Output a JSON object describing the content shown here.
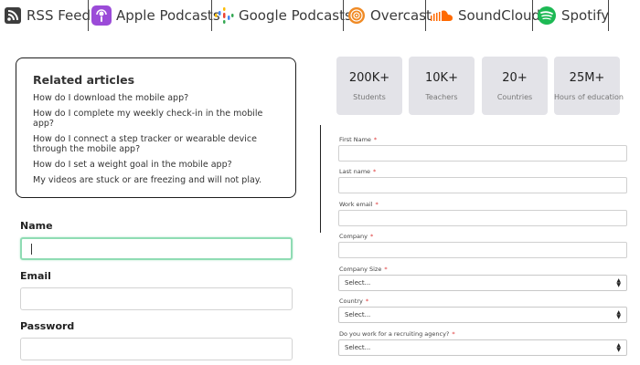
{
  "podcasts": [
    {
      "label": "RSS Feed",
      "icon": "rss-icon"
    },
    {
      "label": "Apple Podcasts",
      "icon": "apple-podcasts-icon"
    },
    {
      "label": "Google Podcasts",
      "icon": "google-podcasts-icon"
    },
    {
      "label": "Overcast",
      "icon": "overcast-icon"
    },
    {
      "label": "SoundCloud",
      "icon": "soundcloud-icon"
    },
    {
      "label": "Spotify",
      "icon": "spotify-icon"
    }
  ],
  "related": {
    "title": "Related articles",
    "articles": [
      "How do I download the mobile app?",
      "How do I complete my weekly check-in in the mobile app?",
      "How do I connect a step tracker or wearable device through the mobile app?",
      "How do I set a weight goal in the mobile app?",
      "My videos are stuck or are freezing and will not play."
    ]
  },
  "left_form": {
    "name_label": "Name",
    "email_label": "Email",
    "password_label": "Password"
  },
  "stats": [
    {
      "number": "200K+",
      "label": "Students"
    },
    {
      "number": "10K+",
      "label": "Teachers"
    },
    {
      "number": "20+",
      "label": "Countries"
    },
    {
      "number": "25M+",
      "label": "Hours of education"
    }
  ],
  "right_form": {
    "first_name_label": "First Name",
    "last_name_label": "Last name",
    "work_email_label": "Work email",
    "company_label": "Company",
    "company_size_label": "Company Size",
    "company_size_value": "Select...",
    "country_label": "Country",
    "country_value": "Select...",
    "agency_label": "Do you work for a recruiting agency?",
    "agency_value": "Select...",
    "required_mark": "*"
  },
  "colors": {
    "rss": "#3d3d3d",
    "apple_podcasts": "#9b4bd8",
    "overcast": "#f08a24",
    "soundcloud": "#ff6a00",
    "spotify": "#1db954",
    "stat_bg": "#e3e3e8",
    "focus_border": "#8fdcb4"
  }
}
